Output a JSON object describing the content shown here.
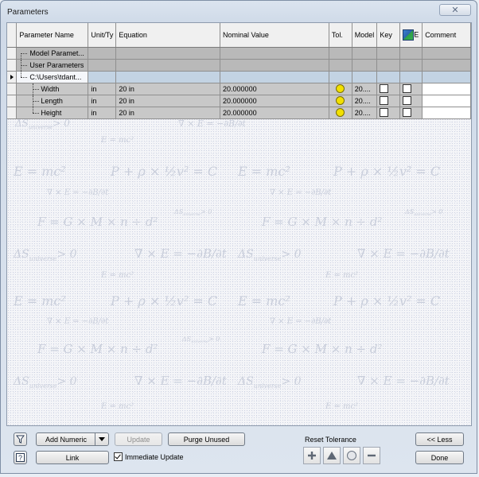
{
  "window": {
    "title": "Parameters",
    "close_glyph": "✕"
  },
  "table": {
    "headers": {
      "name": "Parameter Name",
      "unit": "Unit/Ty",
      "equation": "Equation",
      "nominal": "Nominal Value",
      "tol": "Tol.",
      "model": "Model",
      "key": "Key",
      "export_icon": "export-parameter-icon",
      "export_e": "E",
      "comment": "Comment"
    },
    "groups": {
      "model": "Model Paramet...",
      "user": "User Parameters",
      "file": "C:\\Users\\tdant..."
    },
    "rows": [
      {
        "name": "Width",
        "unit": "in",
        "equation": "20 in",
        "nominal": "20.000000",
        "model": "20...."
      },
      {
        "name": "Length",
        "unit": "in",
        "equation": "20 in",
        "nominal": "20.000000",
        "model": "20...."
      },
      {
        "name": "Height",
        "unit": "in",
        "equation": "20 in",
        "nominal": "20.000000",
        "model": "20...."
      }
    ],
    "colors": {
      "tolerance_dot": "#f2e000",
      "selected_row": "#c3d3e3"
    }
  },
  "wallpaper": {
    "formulas": [
      "E = mc²",
      "P + ρ × ½v² = C",
      "∇ × E = −∂B/∂t",
      "F = G × M × n ÷ d²",
      "ΔS",
      "universe",
      "> 0"
    ]
  },
  "buttons": {
    "add_numeric": "Add Numeric",
    "update": "Update",
    "purge_unused": "Purge Unused",
    "link": "Link",
    "less": "<< Less",
    "done": "Done"
  },
  "immediate_update": {
    "label": "Immediate Update",
    "checked": true
  },
  "reset_tolerance": {
    "label": "Reset Tolerance",
    "icons": [
      "plus-icon",
      "triangle-icon",
      "circle-icon",
      "minus-icon"
    ]
  },
  "left_icons": {
    "filter": "filter-icon",
    "help": "help-icon"
  }
}
